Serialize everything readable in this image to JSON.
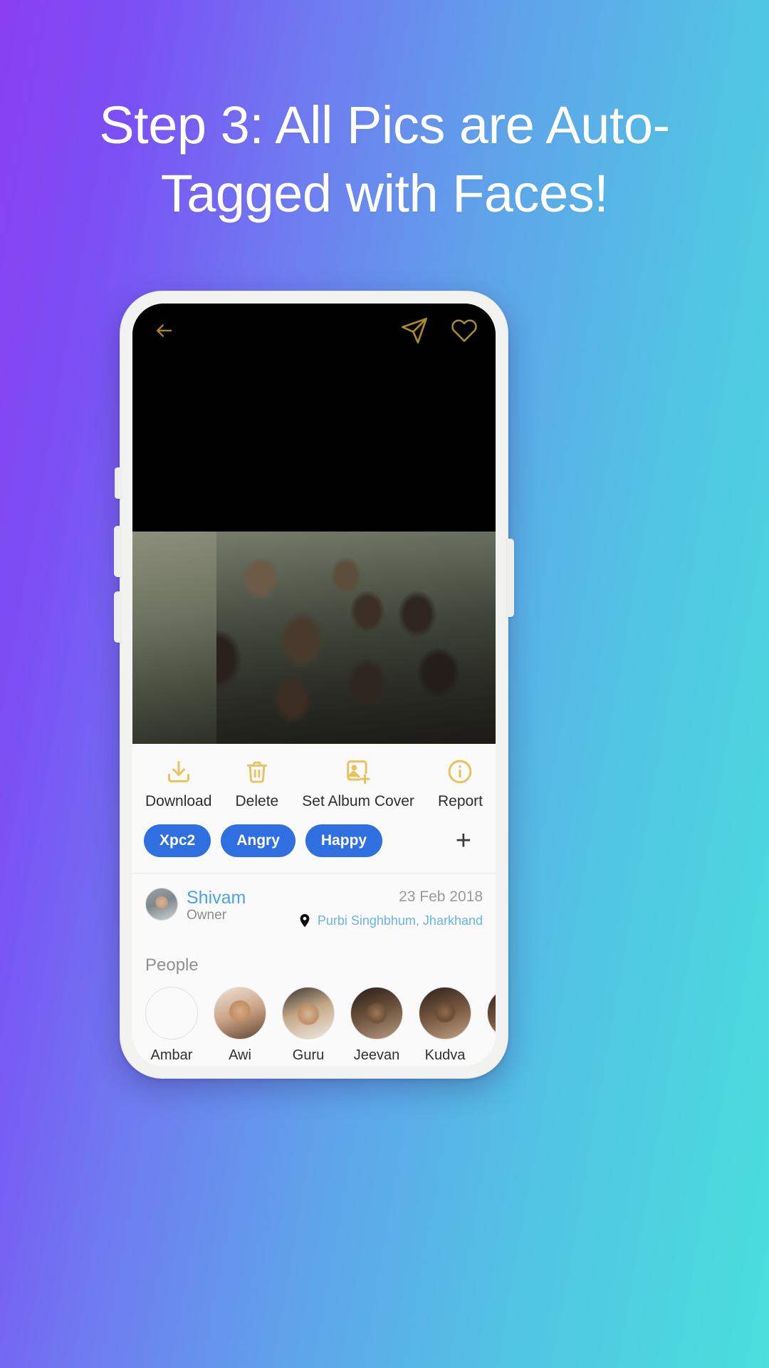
{
  "headline": "Step 3: All Pics are Auto-Tagged with Faces!",
  "colors": {
    "accent_gold": "#e8c25a",
    "chip_blue": "#2f6fe0",
    "link_blue": "#4aa3e8",
    "bg_gradient_start": "#8a3ff0",
    "bg_gradient_end": "#49dfdc"
  },
  "phone": {
    "nav": {
      "back": "back-arrow-icon",
      "share": "share-paper-plane-icon",
      "favorite": "heart-icon"
    },
    "actions": [
      {
        "label": "Download",
        "icon": "download-icon"
      },
      {
        "label": "Delete",
        "icon": "trash-icon"
      },
      {
        "label": "Set Album Cover",
        "icon": "image-plus-icon"
      },
      {
        "label": "Report",
        "icon": "info-circle-icon"
      }
    ],
    "tags": [
      "Xpc2",
      "Angry",
      "Happy"
    ],
    "add_tag_label": "+",
    "owner": {
      "name": "Shivam",
      "role": "Owner"
    },
    "date": "23 Feb 2018",
    "location": "Purbi Singhbhum, Jharkhand",
    "location_icon": "map-pin-icon",
    "people_title": "People",
    "people": [
      {
        "name": "Ambar"
      },
      {
        "name": "Awi"
      },
      {
        "name": "Guru"
      },
      {
        "name": "Jeevan"
      },
      {
        "name": "Kudva"
      },
      {
        "name": ""
      }
    ]
  }
}
